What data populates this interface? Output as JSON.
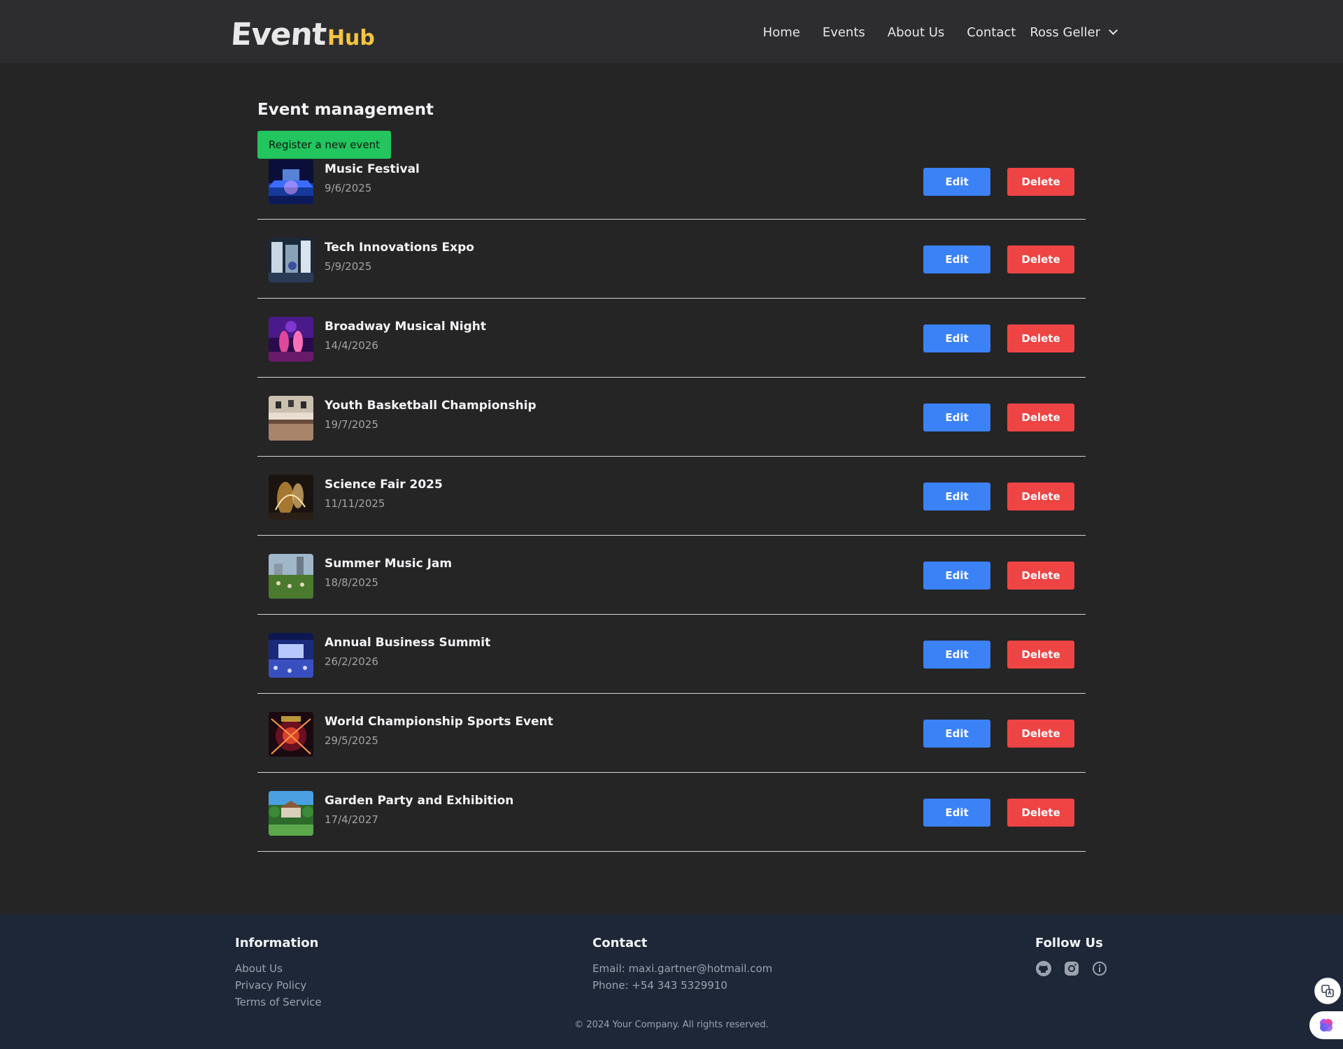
{
  "header": {
    "logo_main": "Event",
    "logo_accent": "Hub",
    "nav": [
      "Home",
      "Events",
      "About Us",
      "Contact"
    ],
    "user_name": "Ross Geller"
  },
  "main": {
    "title": "Event management",
    "register_label": "Register a new event",
    "edit_label": "Edit",
    "delete_label": "Delete",
    "events": [
      {
        "title": "Music Festival",
        "date": "9/6/2025"
      },
      {
        "title": "Tech Innovations Expo",
        "date": "5/9/2025"
      },
      {
        "title": "Broadway Musical Night",
        "date": "14/4/2026"
      },
      {
        "title": "Youth Basketball Championship",
        "date": "19/7/2025"
      },
      {
        "title": "Science Fair 2025",
        "date": "11/11/2025"
      },
      {
        "title": "Summer Music Jam",
        "date": "18/8/2025"
      },
      {
        "title": "Annual Business Summit",
        "date": "26/2/2026"
      },
      {
        "title": "World Championship Sports Event",
        "date": "29/5/2025"
      },
      {
        "title": "Garden Party and Exhibition",
        "date": "17/4/2027"
      }
    ]
  },
  "footer": {
    "info_title": "Information",
    "info_links": [
      "About Us",
      "Privacy Policy",
      "Terms of Service"
    ],
    "contact_title": "Contact",
    "email": "Email: maxi.gartner@hotmail.com",
    "phone": "Phone: +54 343 5329910",
    "follow_title": "Follow Us",
    "social_icons": [
      "github-icon",
      "instagram-icon",
      "info-circle-icon"
    ],
    "copyright": "© 2024 Your Company. All rights reserved."
  },
  "colors": {
    "background": "#252526",
    "header": "#2d2d30",
    "footer": "#1e2738",
    "register_button": "#22c55e",
    "edit_button": "#3b82f6",
    "delete_button": "#ef4444",
    "logo_accent": "#f5c542"
  }
}
